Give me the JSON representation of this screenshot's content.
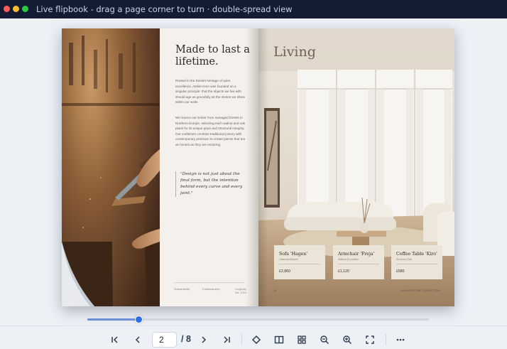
{
  "window": {
    "title": "Live flipbook - drag a page corner to turn · double-spread view"
  },
  "left_page": {
    "headline": "Made to last a lifetime.",
    "paragraph_1": "Rooted in the Danish heritage of quiet excellence, Atelier Kern was founded on a singular principle: that the objects we live with should age as gracefully as the stories we share within our walls.",
    "paragraph_2": "We source our timber from managed forests in Northern Europe, selecting each walnut and oak plank for its unique grain and structural integrity. Our craftsmen combine traditional joinery with contemporary precision to create pieces that are as honest as they are enduring.",
    "quote": "\"Design is not just about the final form, but the intention behind every curve and every joint.\"",
    "footer": [
      "Sustainability",
      "Craftsmanship",
      "Longevity\nEst. 2024"
    ]
  },
  "right_page": {
    "heading": "Living",
    "products": [
      {
        "name": "Sofa 'Hagen'",
        "material": "Oatmeal Bouclé",
        "price": "£2,860"
      },
      {
        "name": "Armchair 'Freja'",
        "material": "Walnut & Leather",
        "price": "£1,120"
      },
      {
        "name": "Coffee Table 'Kiro'",
        "material": "Smoked Oak",
        "price": "£680"
      }
    ],
    "page_number": "34",
    "collection": "LIVING ROOM COLLECTION"
  },
  "progress": {
    "fraction": 0.15
  },
  "toolbar": {
    "current_page": "2",
    "total_pages": "/ 8",
    "icons": [
      "first-page-icon",
      "prev-page-icon",
      "next-page-icon",
      "last-page-icon",
      "single-page-icon",
      "double-spread-icon",
      "thumbnails-icon",
      "zoom-out-icon",
      "zoom-in-icon",
      "fullscreen-icon",
      "more-icon"
    ]
  },
  "colors": {
    "accent": "#2f6be3",
    "titlebar": "#141c33"
  }
}
